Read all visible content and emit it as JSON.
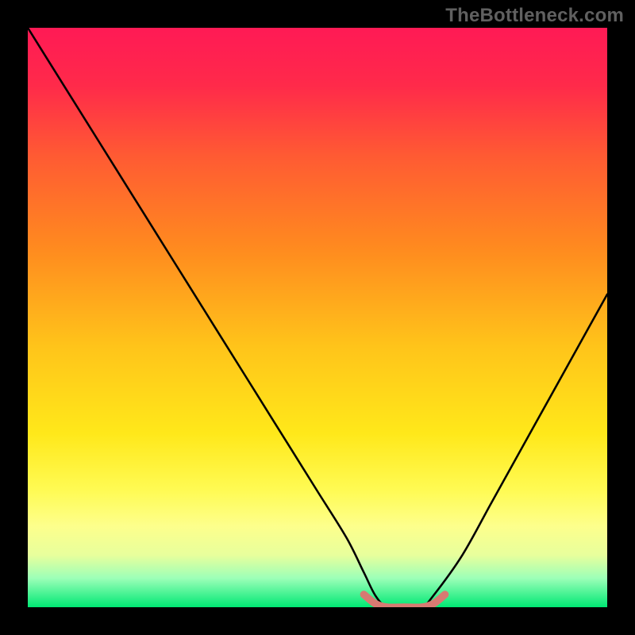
{
  "watermark": "TheBottleneck.com",
  "chart_data": {
    "type": "line",
    "title": "",
    "xlabel": "",
    "ylabel": "",
    "xlim": [
      0,
      100
    ],
    "ylim": [
      0,
      100
    ],
    "series": [
      {
        "name": "bottleneck-curve",
        "x": [
          0,
          5,
          10,
          15,
          20,
          25,
          30,
          35,
          40,
          45,
          50,
          55,
          58,
          60,
          62,
          65,
          68,
          70,
          75,
          80,
          85,
          90,
          95,
          100
        ],
        "y": [
          100,
          92,
          84,
          76,
          68,
          60,
          52,
          44,
          36,
          28,
          20,
          12,
          6,
          2,
          0,
          0,
          0,
          2,
          9,
          18,
          27,
          36,
          45,
          54
        ]
      },
      {
        "name": "optimal-range-marker",
        "x": [
          58,
          60,
          62,
          65,
          68,
          70,
          72
        ],
        "y": [
          2.2,
          0.6,
          0,
          0,
          0,
          0.6,
          2.2
        ]
      }
    ],
    "gradient_stops": [
      {
        "pct": 0,
        "color": "#ff1a55"
      },
      {
        "pct": 10,
        "color": "#ff2a4a"
      },
      {
        "pct": 22,
        "color": "#ff5a33"
      },
      {
        "pct": 38,
        "color": "#ff8a1f"
      },
      {
        "pct": 55,
        "color": "#ffc41a"
      },
      {
        "pct": 70,
        "color": "#ffe81a"
      },
      {
        "pct": 80,
        "color": "#fffb55"
      },
      {
        "pct": 86,
        "color": "#fdff8c"
      },
      {
        "pct": 91,
        "color": "#e8ff9c"
      },
      {
        "pct": 95,
        "color": "#9cffb8"
      },
      {
        "pct": 100,
        "color": "#00e874"
      }
    ],
    "marker_color": "#d77a72"
  }
}
